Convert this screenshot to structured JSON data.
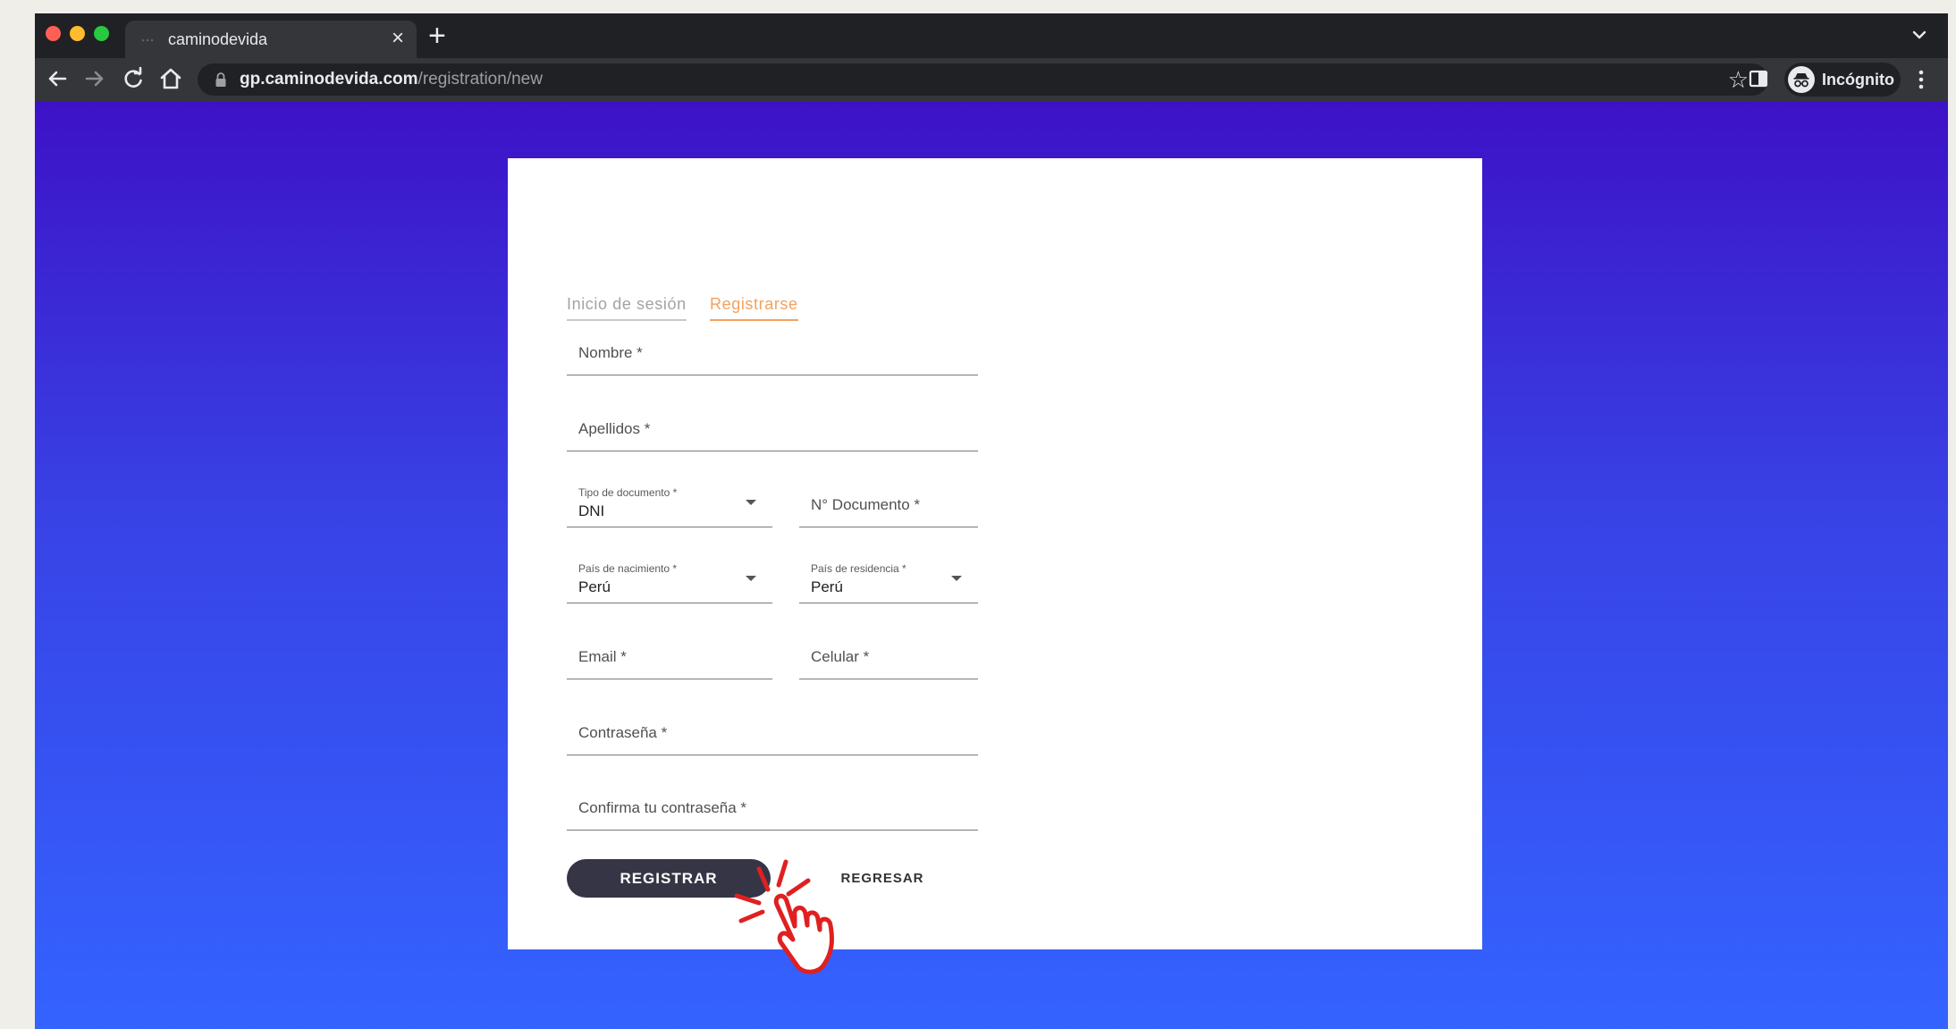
{
  "browser": {
    "tab_title": "caminodevida",
    "tab_close": "×",
    "new_tab": "+",
    "url_domain": "gp.caminodevida.com",
    "url_path": "/registration/new",
    "bookmark_star": "☆",
    "profile_label": "Incógnito"
  },
  "auth_tabs": {
    "login": "Inicio de sesión",
    "register": "Registrarse",
    "active": "register"
  },
  "form": {
    "nombre": "Nombre *",
    "apellidos": "Apellidos *",
    "tipo_documento": {
      "label": "Tipo de documento *",
      "value": "DNI"
    },
    "numero_documento": "N° Documento *",
    "pais_nacimiento": {
      "label": "País de nacimiento *",
      "value": "Perú"
    },
    "pais_residencia": {
      "label": "País de residencia *",
      "value": "Perú"
    },
    "email": "Email *",
    "celular": "Celular *",
    "contrasena": "Contraseña *",
    "confirmar_contrasena": "Confirma tu contraseña *"
  },
  "actions": {
    "register": "REGISTRAR",
    "back": "REGRESAR"
  },
  "colors": {
    "accent_orange": "#f3a15f",
    "button_dark": "#353545",
    "gradient_top": "#3d12c6",
    "gradient_bottom": "#3463ff",
    "cursor_red": "#e02020"
  },
  "icons": [
    "back-arrow-icon",
    "forward-arrow-icon",
    "reload-icon",
    "home-icon",
    "lock-icon",
    "star-icon",
    "side-panel-icon",
    "incognito-icon",
    "kebab-menu-icon",
    "chevron-down-icon",
    "caret-down-icon",
    "hand-pointer-icon"
  ]
}
